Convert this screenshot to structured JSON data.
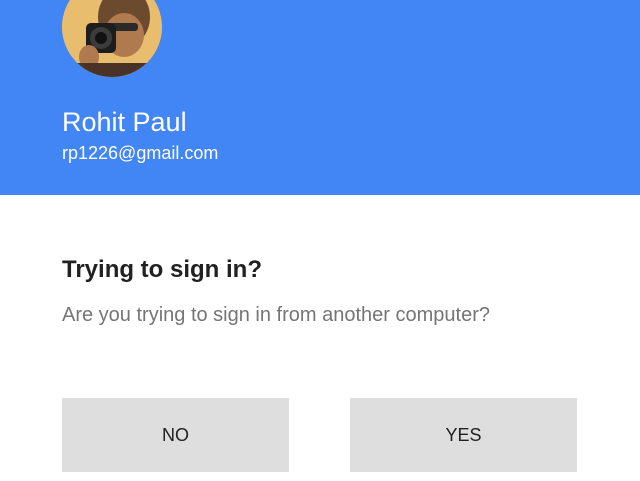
{
  "account": {
    "name": "Rohit Paul",
    "email": "rp1226@gmail.com"
  },
  "prompt": {
    "title": "Trying to sign in?",
    "question": "Are you trying to sign in from another computer?"
  },
  "actions": {
    "no_label": "NO",
    "yes_label": "YES"
  },
  "colors": {
    "header": "#4285f4",
    "button": "#dedede",
    "title_text": "#212121",
    "body_text": "#757575"
  }
}
